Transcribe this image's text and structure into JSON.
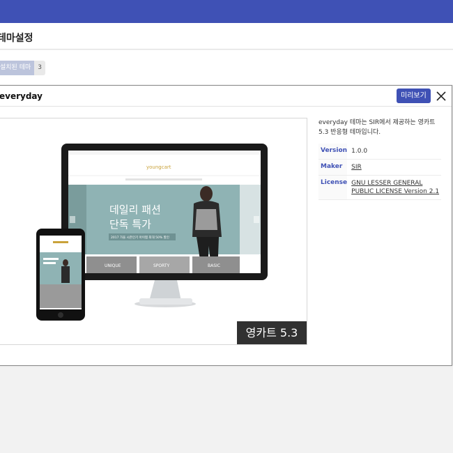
{
  "page": {
    "title": "테마설정",
    "theme_count_label": "설치된 테마",
    "theme_count": "3"
  },
  "modal": {
    "title": "everyday",
    "preview_label": "미리보기",
    "close_icon": "close-icon",
    "screenshot": {
      "brand": "youngcart",
      "banner_line1": "데일리 패션",
      "banner_line2": "단독 특가",
      "banner_sub": "2017 가을 시즌인기 아이템 최대 50% 할인",
      "tiles": [
        "UNIQUE",
        "SPORTY",
        "BASIC"
      ],
      "caption": "영카트 5.3"
    },
    "description": "everyday 테마는 SIR에서 제공하는 영카트 5.3 반응형 테마입니다.",
    "info": {
      "version_label": "Version",
      "version": "1.0.0",
      "maker_label": "Maker",
      "maker": "SIR",
      "license_label": "License",
      "license": "GNU LESSER GENERAL PUBLIC LICENSE Version 2.1"
    }
  },
  "colors": {
    "accent": "#3f51b5",
    "banner_bg": "#8fb3b4"
  }
}
